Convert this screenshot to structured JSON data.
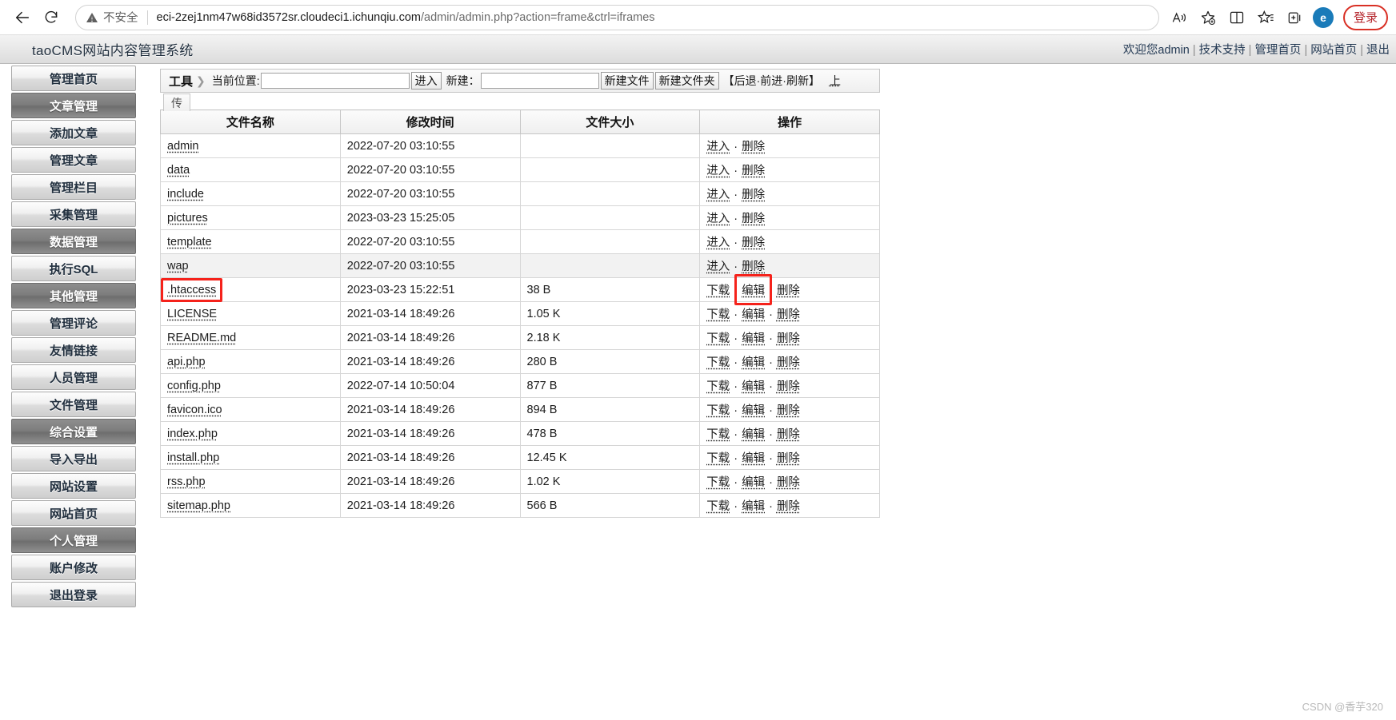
{
  "browser": {
    "back_label": "back-arrow",
    "reload_label": "reload-arrow",
    "security_label": "不安全",
    "url_host": "eci-2zej1nm47w68id3572sr.cloudeci1.ichunqiu.com",
    "url_path": "/admin/admin.php?action=frame&ctrl=iframes",
    "read_aloud_label": "A",
    "profile_label": "登录"
  },
  "app": {
    "title": "taoCMS网站内容管理系统",
    "header_links": [
      "欢迎您admin",
      "技术支持",
      "管理首页",
      "网站首页",
      "退出"
    ]
  },
  "sidebar": {
    "items": [
      {
        "label": "管理首页",
        "style": "light"
      },
      {
        "label": "文章管理",
        "style": "dark"
      },
      {
        "label": "添加文章",
        "style": "light"
      },
      {
        "label": "管理文章",
        "style": "light"
      },
      {
        "label": "管理栏目",
        "style": "light"
      },
      {
        "label": "采集管理",
        "style": "light"
      },
      {
        "label": "数据管理",
        "style": "dark"
      },
      {
        "label": "执行SQL",
        "style": "light"
      },
      {
        "label": "其他管理",
        "style": "dark"
      },
      {
        "label": "管理评论",
        "style": "light"
      },
      {
        "label": "友情链接",
        "style": "light"
      },
      {
        "label": "人员管理",
        "style": "light"
      },
      {
        "label": "文件管理",
        "style": "light"
      },
      {
        "label": "综合设置",
        "style": "dark"
      },
      {
        "label": "导入导出",
        "style": "light"
      },
      {
        "label": "网站设置",
        "style": "light"
      },
      {
        "label": "网站首页",
        "style": "light"
      },
      {
        "label": "个人管理",
        "style": "dark"
      },
      {
        "label": "账户修改",
        "style": "light"
      },
      {
        "label": "退出登录",
        "style": "light"
      }
    ]
  },
  "toolbar": {
    "tool_label": "工具",
    "current_path_label": "当前位置:",
    "current_path_value": "",
    "enter_button": "进入",
    "new_label": "新建：",
    "new_value": "",
    "new_file_button": "新建文件",
    "new_folder_button": "新建文件夹",
    "nav_text": "【后退·前进·刷新】",
    "up_link": "上",
    "upload_tab": "传"
  },
  "table": {
    "headers": [
      "文件名称",
      "修改时间",
      "文件大小",
      "操作"
    ],
    "dir_ops": [
      "进入",
      "删除"
    ],
    "file_ops": [
      "下载",
      "编辑",
      "删除"
    ],
    "rows": [
      {
        "name": "admin",
        "time": "2022-07-20 03:10:55",
        "size": "",
        "type": "dir"
      },
      {
        "name": "data",
        "time": "2022-07-20 03:10:55",
        "size": "",
        "type": "dir"
      },
      {
        "name": "include",
        "time": "2022-07-20 03:10:55",
        "size": "",
        "type": "dir"
      },
      {
        "name": "pictures",
        "time": "2023-03-23 15:25:05",
        "size": "",
        "type": "dir"
      },
      {
        "name": "template",
        "time": "2022-07-20 03:10:55",
        "size": "",
        "type": "dir"
      },
      {
        "name": "wap",
        "time": "2022-07-20 03:10:55",
        "size": "",
        "type": "dir",
        "hovered": true
      },
      {
        "name": ".htaccess",
        "time": "2023-03-23 15:22:51",
        "size": "38 B",
        "type": "file",
        "highlight_name": true,
        "highlight_edit": true
      },
      {
        "name": "LICENSE",
        "time": "2021-03-14 18:49:26",
        "size": "1.05 K",
        "type": "file"
      },
      {
        "name": "README.md",
        "time": "2021-03-14 18:49:26",
        "size": "2.18 K",
        "type": "file"
      },
      {
        "name": "api.php",
        "time": "2021-03-14 18:49:26",
        "size": "280 B",
        "type": "file"
      },
      {
        "name": "config.php",
        "time": "2022-07-14 10:50:04",
        "size": "877 B",
        "type": "file"
      },
      {
        "name": "favicon.ico",
        "time": "2021-03-14 18:49:26",
        "size": "894 B",
        "type": "file"
      },
      {
        "name": "index.php",
        "time": "2021-03-14 18:49:26",
        "size": "478 B",
        "type": "file"
      },
      {
        "name": "install.php",
        "time": "2021-03-14 18:49:26",
        "size": "12.45 K",
        "type": "file"
      },
      {
        "name": "rss.php",
        "time": "2021-03-14 18:49:26",
        "size": "1.02 K",
        "type": "file"
      },
      {
        "name": "sitemap.php",
        "time": "2021-03-14 18:49:26",
        "size": "566 B",
        "type": "file"
      }
    ]
  },
  "watermark": "CSDN @香芋320",
  "colors": {
    "highlight": "#f5221b",
    "accent": "#1a7bb9",
    "profile_border": "#d93025"
  }
}
